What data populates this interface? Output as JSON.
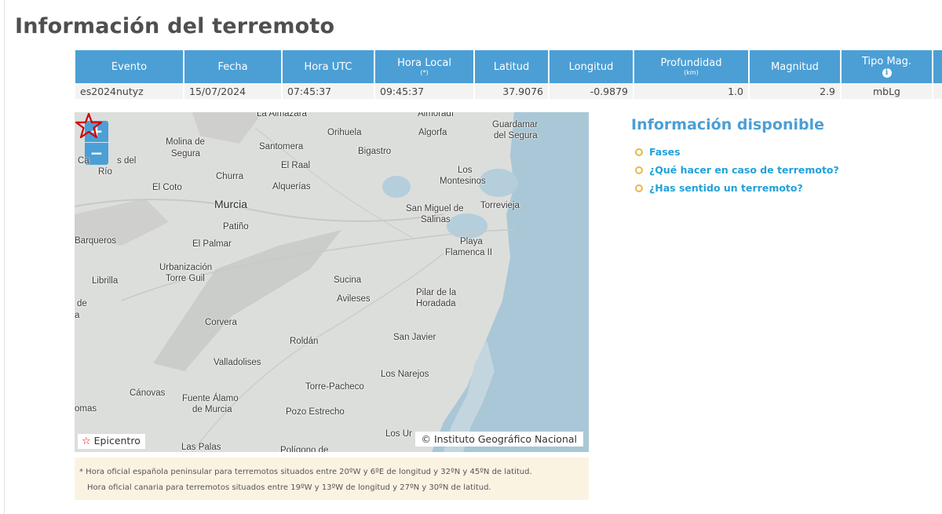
{
  "page": {
    "title": "Información del terremoto"
  },
  "table": {
    "headers": {
      "evento": "Evento",
      "fecha": "Fecha",
      "hora_utc": "Hora UTC",
      "hora_local": "Hora Local",
      "hora_local_note": "(*)",
      "latitud": "Latitud",
      "longitud": "Longitud",
      "profundidad": "Profundidad",
      "profundidad_unit": "(km)",
      "magnitud": "Magnitud",
      "tipo_mag": "Tipo Mag.",
      "tipo_mag_icon": "info-icon"
    },
    "row": {
      "evento": "es2024nutyz",
      "fecha": "15/07/2024",
      "hora_utc": "07:45:37",
      "hora_local": "09:45:37",
      "latitud": "37.9076",
      "longitud": "-0.9879",
      "profundidad": "1.0",
      "magnitud": "2.9",
      "tipo_mag": "mbLg"
    }
  },
  "map": {
    "zoom_in": "+",
    "zoom_out": "−",
    "places": {
      "la_almazara": "La Almazara",
      "almoradi": "Almoradí",
      "guardamar": "Guardamar",
      "del_segura": "del Segura",
      "orihuela": "Orihuela",
      "algorfa": "Algorfa",
      "molina": "Molina de",
      "segura": "Segura",
      "santomera": "Santomera",
      "bigastro": "Bigastro",
      "ca": "Ca",
      "s_del": "s del",
      "rio": "Río",
      "churra": "Churra",
      "el_raal": "El Raal",
      "los": "Los",
      "montesinos": "Montesinos",
      "el_coto": "El Coto",
      "alquerias": "Alquerías",
      "murcia": "Murcia",
      "san_miguel": "San Miguel de",
      "salinas": "Salinas",
      "torrevieja": "Torrevieja",
      "patino": "Patiño",
      "barqueros": "Barqueros",
      "el_palmar": "El Palmar",
      "playa": "Playa",
      "flamenca": "Flamenca II",
      "urbanizacion": "Urbanización",
      "torre_guil": "Torre Guil",
      "librilla": "Librilla",
      "sucina": "Sucina",
      "aviles": "Avileses",
      "pilar": "Pilar de la",
      "horadada": "Horadada",
      "de": "de",
      "a": "a",
      "corvera": "Corvera",
      "roldan": "Roldán",
      "san_javier": "San Javier",
      "valladolises": "Valladolises",
      "los_narejos": "Los Narejos",
      "torre_pacheco": "Torre-Pacheco",
      "canovas": "Cánovas",
      "fuente_alamo": "Fuente Álamo",
      "de_murcia": "de Murcia",
      "omas": "omas",
      "pozo_estrecho": "Pozo Estrecho",
      "los_ur": "Los Ur",
      "las_palas": "Las Palas",
      "poligono": "Polígono de"
    },
    "legend_symbol": "☆",
    "legend_label": "Epicentro",
    "credit": "© Instituto Geográfico Nacional",
    "colors": {
      "sea": "#a9c7d6",
      "land": "#dcdedb",
      "epicenter": "#d40000"
    }
  },
  "note": {
    "line1": "* Hora oficial española peninsular para terremotos situados entre 20ºW y 6ºE de longitud y 32ºN y 45ºN de latitud.",
    "line2": "Hora oficial canaria para terremotos situados entre 19ºW y 13ºW de longitud y 27ºN y 30ºN de latitud."
  },
  "info": {
    "title": "Información disponible",
    "links": [
      "Fases",
      "¿Qué hacer en caso de terremoto?",
      "¿Has sentido un terremoto?"
    ]
  },
  "colors": {
    "accent": "#4b9fd5",
    "link": "#23a1d9",
    "bullet": "#e8b84b",
    "note_bg": "#fbf3e2"
  }
}
